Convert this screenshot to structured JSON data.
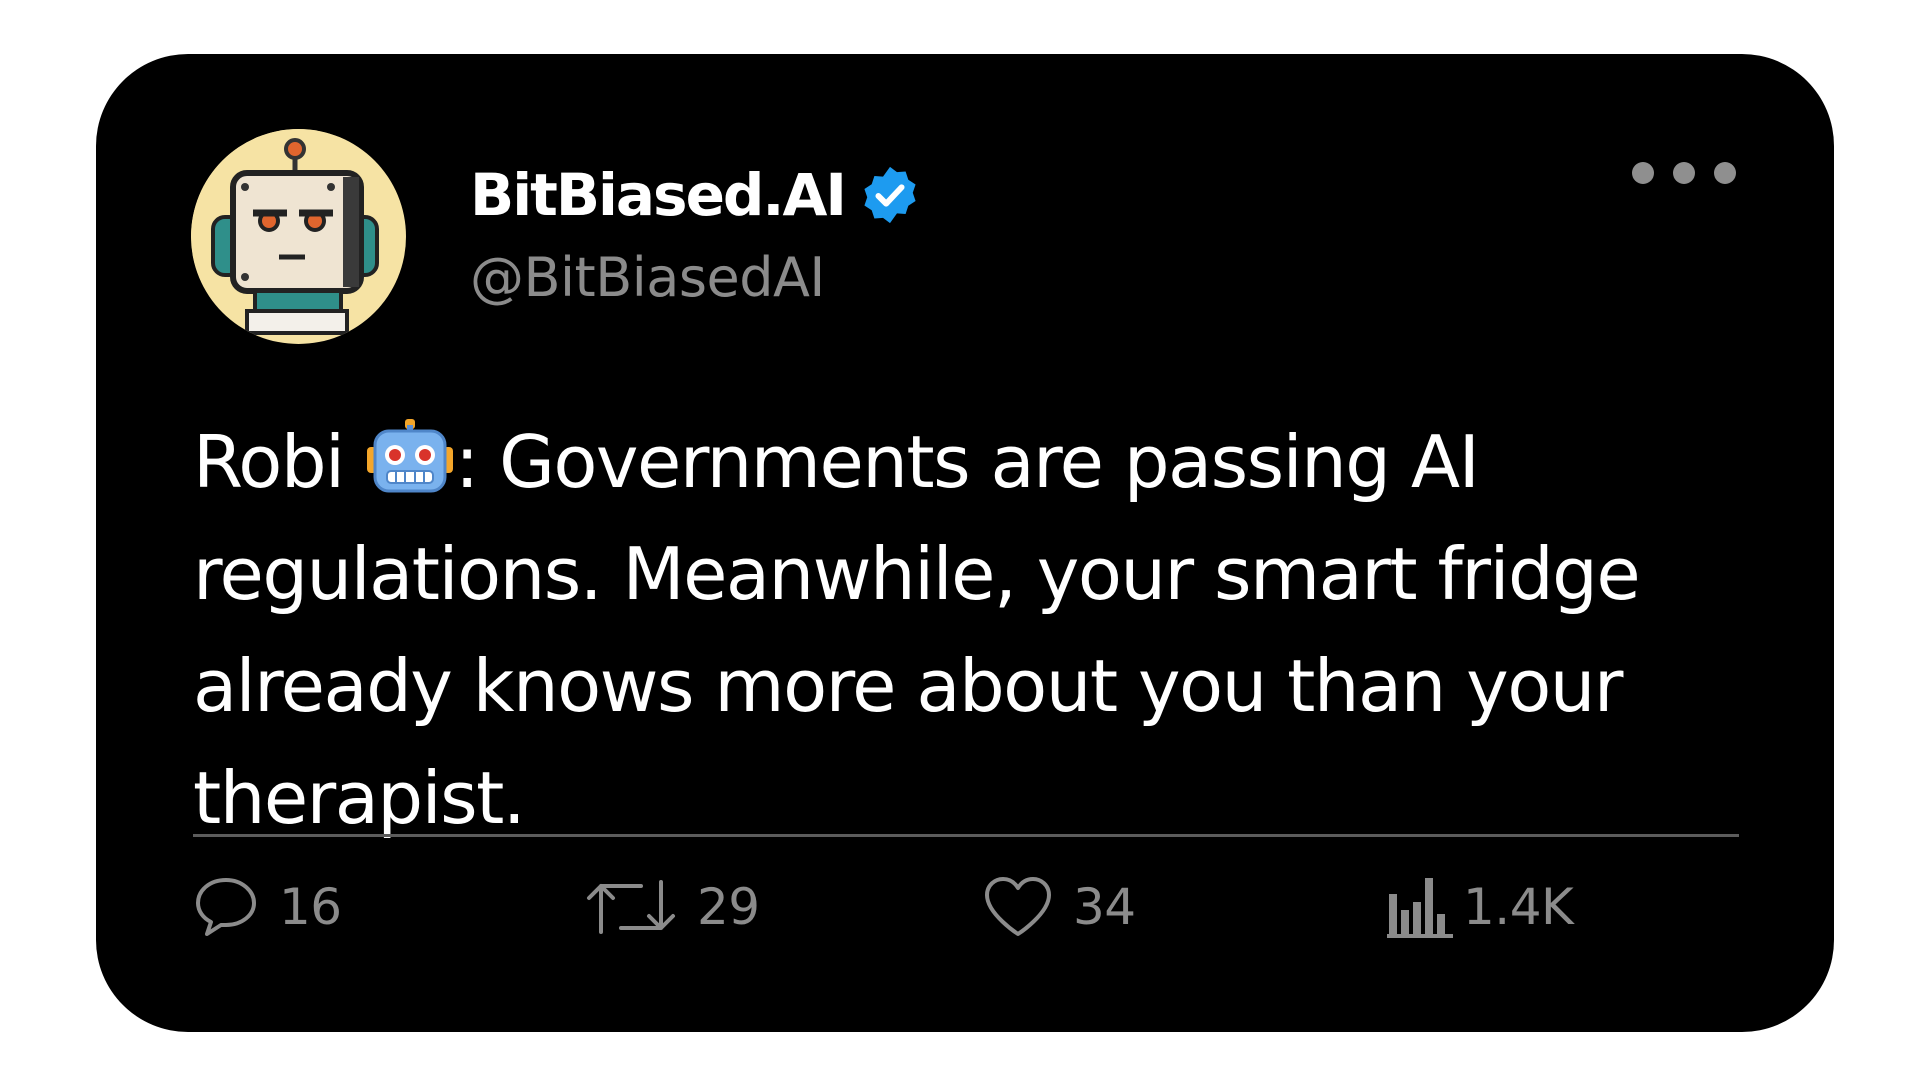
{
  "post": {
    "author": {
      "display_name": "BitBiased.AI",
      "handle": "@BitBiasedAI",
      "verified": true,
      "avatar_icon": "robot-avatar-icon"
    },
    "text_prefix": "Robi ",
    "text_emoji": "robot-face-emoji",
    "text_body": ": Governments are passing AI regulations. Meanwhile, your smart fridge already knows more about you than your therapist.",
    "stats": {
      "replies": "16",
      "reposts": "29",
      "likes": "34",
      "views": "1.4K"
    }
  },
  "colors": {
    "card_background": "#000000",
    "page_background": "#ffffff",
    "verified_badge": "#1d9bf0",
    "secondary_text": "#8b8b8b",
    "avatar_background": "#f6e3a4"
  },
  "icons": {
    "more": "more-options-icon",
    "reply": "reply-icon",
    "repost": "repost-icon",
    "like": "heart-icon",
    "views": "views-chart-icon",
    "verified": "verified-badge-icon"
  }
}
